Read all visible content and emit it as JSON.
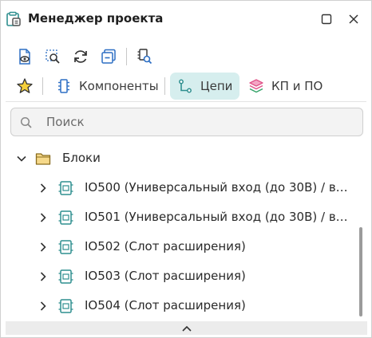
{
  "window": {
    "title": "Менеджер проекта"
  },
  "toolbar": {
    "icons": [
      "document-view-icon",
      "zoom-select-icon",
      "refresh-icon",
      "collapse-all-icon",
      "find-in-project-icon"
    ]
  },
  "tabs": [
    {
      "label": "Компоненты",
      "icon": "component-icon",
      "active": false
    },
    {
      "label": "Цепи",
      "icon": "net-icon",
      "active": true
    },
    {
      "label": "КП и ПО",
      "icon": "layers-icon",
      "active": false
    }
  ],
  "search": {
    "placeholder": "Поиск",
    "value": ""
  },
  "tree": {
    "root": {
      "label": "Блоки",
      "expanded": true
    },
    "items": [
      {
        "label": "IO500 (Универсальный вход (до 30В) / вых..."
      },
      {
        "label": "IO501 (Универсальный вход (до 30В) / выхо..."
      },
      {
        "label": "IO502 (Слот расширения)"
      },
      {
        "label": "IO503 (Слот расширения)"
      },
      {
        "label": "IO504 (Слот расширения)"
      }
    ]
  },
  "colors": {
    "accent_teal": "#2f8f8f",
    "tab_active_bg": "#d6eeee",
    "star_fill": "#f5cf3a",
    "folder_fill": "#f6d98a",
    "layers_pink": "#e0558a",
    "layers_green": "#36a36a",
    "toolbar_blue": "#2d6fc4"
  }
}
